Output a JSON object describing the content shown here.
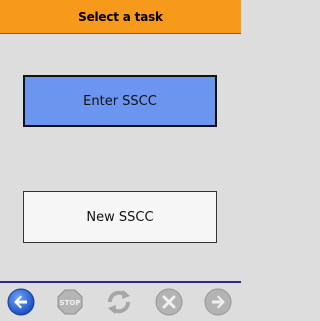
{
  "header": {
    "title": "Select a task"
  },
  "tasks": [
    {
      "label": "Enter SSCC"
    },
    {
      "label": "New SSCC"
    }
  ],
  "toolbar": {
    "stop_label": "STOP"
  },
  "colors": {
    "header": "#f79a1c",
    "background": "#dddddd",
    "primary_button": "#6b95ef",
    "secondary_button": "#f6f6f6",
    "back_icon": "#2f6fe0",
    "disabled_icon": "#aaaaaa"
  },
  "icons": [
    "back-icon",
    "stop-icon",
    "refresh-icon",
    "cancel-icon",
    "forward-icon"
  ]
}
